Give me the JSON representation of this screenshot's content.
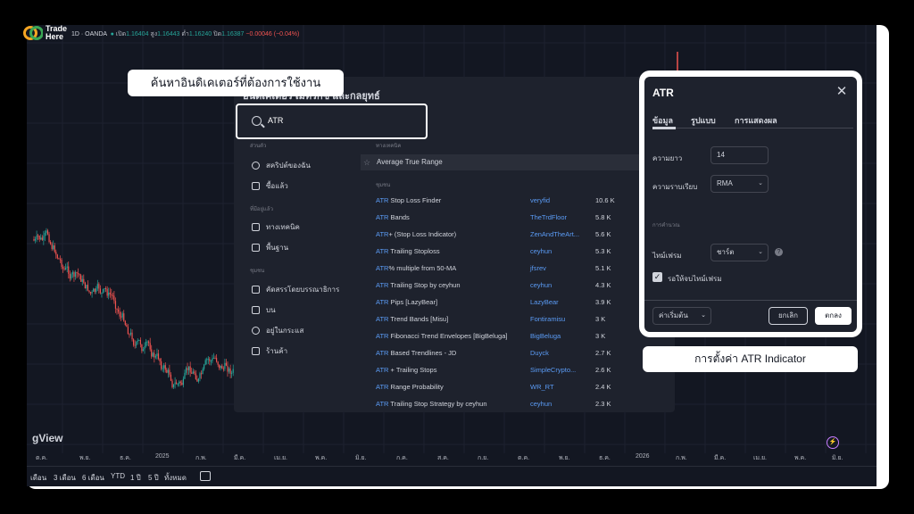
{
  "brand": {
    "line1": "Trade",
    "line2": "Here"
  },
  "chart": {
    "symbol_line": {
      "interval": "1D · OANDA",
      "open_label": "เปิด",
      "open": "1.16404",
      "high_label": "สูง",
      "high": "1.16443",
      "low_label": "ต่ำ",
      "low": "1.16240",
      "close_label": "ปิด",
      "close": "1.16387",
      "change": "−0.00046 (−0.04%)"
    },
    "watermark": "gView",
    "x_labels": [
      "ต.ค.",
      "พ.ย.",
      "ธ.ค.",
      "2025",
      "ก.พ.",
      "มี.ค.",
      "เม.ย.",
      "พ.ค.",
      "มิ.ย.",
      "ก.ค.",
      "ส.ค.",
      "ก.ย.",
      "ต.ค.",
      "พ.ย.",
      "ธ.ค.",
      "2026",
      "ก.พ.",
      "มี.ค.",
      "เม.ย.",
      "พ.ค.",
      "มิ.ย."
    ],
    "timeframes": [
      "เดือน",
      "3 เดือน",
      "6 เดือน",
      "YTD",
      "1 ปี",
      "5 ปี",
      "ทั้งหมด"
    ]
  },
  "indicators": {
    "title": "อินดิเคเตอร์ เมทริกซ์ และกลยุทธ์",
    "search_value": "ATR",
    "sidebar": {
      "section1": "ส่วนตัว",
      "items1": [
        "สคริปต์ของฉัน",
        "ซื้อแล้ว"
      ],
      "section2": "ที่มีอยู่แล้ว",
      "items2": [
        "ทางเทคนิค",
        "พื้นฐาน"
      ],
      "section3": "ชุมชน",
      "items3": [
        "คัดสรรโดยบรรณาธิการ",
        "บน",
        "อยู่ในกระแส",
        "ร้านค้า"
      ]
    },
    "tech_header": "ทางเทคนิค",
    "top_result": "Average True Range",
    "community_header": "ชุมชน",
    "results": [
      {
        "prefix": "ATR",
        "rest": " Stop Loss Finder",
        "author": "veryfid",
        "count": "10.6 K"
      },
      {
        "prefix": "ATR",
        "rest": " Bands",
        "author": "TheTrdFloor",
        "count": "5.8 K"
      },
      {
        "prefix": "ATR",
        "rest": "+ (Stop Loss Indicator)",
        "author": "ZenAndTheArt...",
        "count": "5.6 K"
      },
      {
        "prefix": "ATR",
        "rest": " Trailing Stoploss",
        "author": "ceyhun",
        "count": "5.3 K"
      },
      {
        "prefix": "ATR",
        "rest": "% multiple from 50-MA",
        "author": "jfsrev",
        "count": "5.1 K"
      },
      {
        "prefix": "ATR",
        "rest": " Trailing Stop by ceyhun",
        "author": "ceyhun",
        "count": "4.3 K"
      },
      {
        "prefix": "ATR",
        "rest": " Pips [LazyBear]",
        "author": "LazyBear",
        "count": "3.9 K"
      },
      {
        "prefix": "ATR",
        "rest": " Trend Bands [Misu]",
        "author": "Fontiramisu",
        "count": "3 K"
      },
      {
        "prefix": "ATR",
        "rest": " Fibonacci Trend Envelopes [BigBeluga]",
        "author": "BigBeluga",
        "count": "3 K"
      },
      {
        "prefix": "ATR",
        "rest": " Based Trendlines - JD",
        "author": "Duyck",
        "count": "2.7 K"
      },
      {
        "prefix": "ATR",
        "rest": " + Trailing Stops",
        "author": "SimpleCrypto...",
        "count": "2.6 K"
      },
      {
        "prefix": "ATR",
        "rest": " Range Probability",
        "author": "WR_RT",
        "count": "2.4 K"
      },
      {
        "prefix": "ATR",
        "rest": " Trailing Stop Strategy by ceyhun",
        "author": "ceyhun",
        "count": "2.3 K"
      }
    ]
  },
  "callout_search": "ค้นหาอินดิเคเตอร์ที่ต้องการใช้งาน",
  "settings": {
    "title": "ATR",
    "tabs": [
      "ข้อมูล",
      "รูปแบบ",
      "การแสดงผล"
    ],
    "length_label": "ความยาว",
    "length_value": "14",
    "smoothing_label": "ความราบเรียบ",
    "smoothing_value": "RMA",
    "calc_section": "การคำนวณ",
    "timeframe_label": "ไทม์เฟรม",
    "timeframe_value": "ชาร์ต",
    "wait_label": "รอให้จบไทม์เฟรม",
    "defaults_label": "ค่าเริ่มต้น",
    "cancel": "ยกเลิก",
    "ok": "ตกลง"
  },
  "callout_settings": "การตั้งค่า ATR Indicator",
  "colors": {
    "up": "#26a69a",
    "down": "#ef5350",
    "accent": "#5b9cf6",
    "bg": "#131722"
  }
}
